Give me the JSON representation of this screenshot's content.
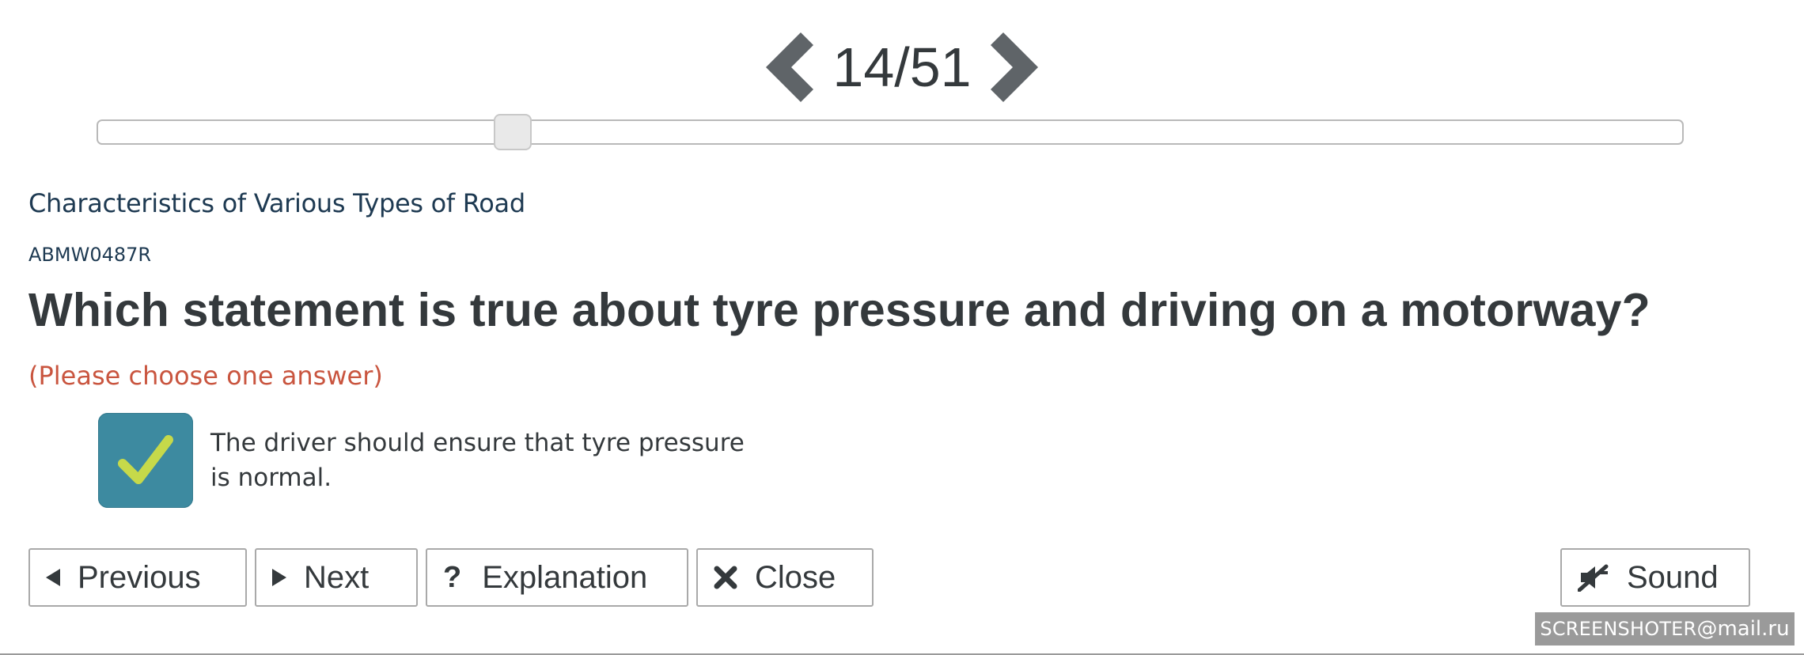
{
  "navigation": {
    "counter": "14/51",
    "current": 14,
    "total": 51,
    "prev_icon": "chevron-left-icon",
    "next_icon": "chevron-right-icon"
  },
  "slider": {
    "value": 14,
    "max": 51
  },
  "question": {
    "category": "Characteristics of Various Types of Road",
    "code": "ABMW0487R",
    "text": "Which statement is true about tyre pressure and driving on a motorway?",
    "instruction": "(Please choose one answer)"
  },
  "answers": [
    {
      "text": "The driver should ensure that tyre pressure is normal.",
      "selected": true,
      "icon": "checkmark-icon"
    }
  ],
  "buttons": {
    "previous": "Previous",
    "next": "Next",
    "explanation": "Explanation",
    "close": "Close",
    "sound": "Sound"
  },
  "watermark": {
    "brand": "SCREENSHOTER",
    "domain": "@mail.ru"
  },
  "colors": {
    "text_dark": "#34393c",
    "category_text": "#1e3a52",
    "instruction": "#c9553f",
    "check_bg": "#3d8aa0",
    "check_mark": "#c6d94a",
    "arrow": "#5f6468",
    "border": "#a9a9a9"
  }
}
